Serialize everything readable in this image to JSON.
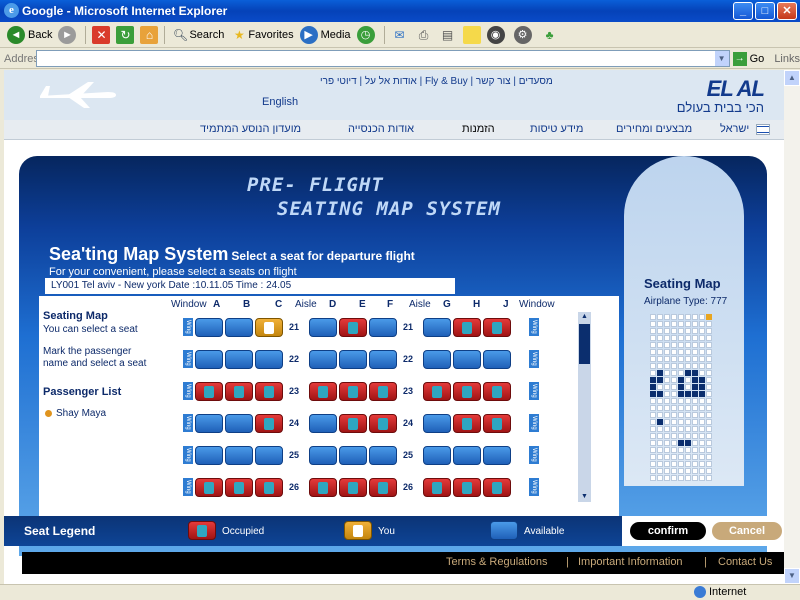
{
  "window": {
    "title": "Google - Microsoft Internet Explorer",
    "min": "_",
    "max": "□",
    "close": "✕"
  },
  "toolbar": {
    "back": "Back",
    "search": "Search",
    "favorites": "Favorites",
    "media": "Media"
  },
  "address": {
    "label": "Address",
    "go": "Go",
    "links": "Links"
  },
  "status": {
    "zone": "Internet"
  },
  "site": {
    "toplinks": "אודות אל על | דיוטי פרי | Fly & Buy | מסעדים | צור קשר",
    "english": "English",
    "logo_en": "EL AL",
    "logo_he": "הכי בבית בעולם",
    "nav": [
      "ישראל",
      "מבצעים ומחירים",
      "מידע טיסות",
      "הזמנות",
      "אודות הכנסייה",
      "מועדון הנוסע המתמיד"
    ],
    "banner1": "PRE- FLIGHT",
    "banner2": "SEATING MAP SYSTEM",
    "heading": "Sea'ting Map System",
    "heading_sub": "Select a seat for departure flight",
    "convenient": "For your convenient, please select a seats on flight",
    "flight": "LY001   Tel aviv - New york   Date :10.11.05   Time : 24.05",
    "instr1_title": "Seating Map",
    "instr1_text": "You can select a seat",
    "instr2_text1": "Mark the passenger",
    "instr2_text2": "name and select a seat",
    "pax_title": "Passenger List",
    "pax_name": "Shay Maya",
    "columns": [
      "Window",
      "A",
      "B",
      "C",
      "Aisle",
      "D",
      "E",
      "F",
      "Aisle",
      "G",
      "H",
      "J",
      "Window"
    ],
    "rows": [
      "21",
      "22",
      "23",
      "24",
      "25",
      "26"
    ],
    "wing": "Wing",
    "map_title": "Seating Map",
    "map_type": "Airplane Type: 777",
    "legend_title": "Seat Legend",
    "legend_occupied": "Occupied",
    "legend_you": "You",
    "legend_available": "Available",
    "confirm": "confirm",
    "cancel": "Cancel",
    "footer": [
      "Terms & Regulations",
      "|",
      "Important Information",
      "|",
      "Contact Us"
    ]
  },
  "seat_status": {
    "21": [
      "a",
      "a",
      "y",
      "a",
      "o",
      "a",
      "a",
      "o",
      "o"
    ],
    "22": [
      "a",
      "a",
      "a",
      "a",
      "a",
      "a",
      "a",
      "a",
      "a"
    ],
    "23": [
      "o",
      "o",
      "o",
      "o",
      "o",
      "o",
      "o",
      "o",
      "o"
    ],
    "24": [
      "a",
      "a",
      "o",
      "a",
      "o",
      "o",
      "a",
      "o",
      "o"
    ],
    "25": [
      "a",
      "a",
      "a",
      "a",
      "a",
      "a",
      "a",
      "a",
      "a"
    ],
    "26": [
      "o",
      "o",
      "o",
      "o",
      "o",
      "o",
      "o",
      "o",
      "o"
    ]
  }
}
